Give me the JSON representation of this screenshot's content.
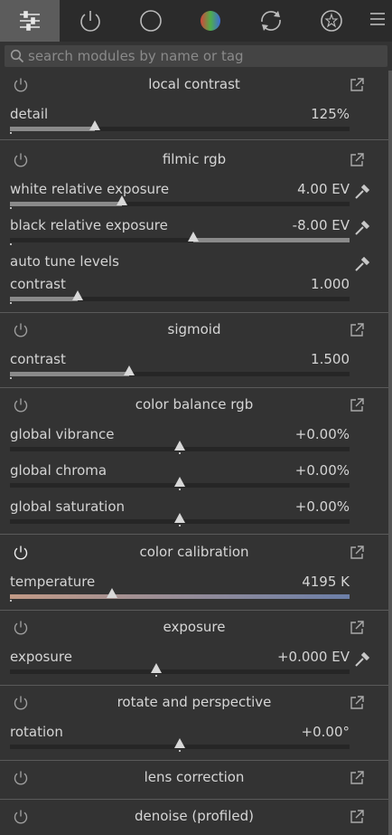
{
  "tabs": [
    {
      "name": "active-modules-tab",
      "icon": "sliders-icon"
    },
    {
      "name": "power-tab",
      "icon": "power-icon"
    },
    {
      "name": "base-tab",
      "icon": "circle-icon"
    },
    {
      "name": "color-tab",
      "icon": "color-wheel-icon"
    },
    {
      "name": "correct-tab",
      "icon": "refresh-icon"
    },
    {
      "name": "effects-tab",
      "icon": "effects-icon"
    }
  ],
  "search": {
    "placeholder": "search modules by name or tag"
  },
  "modules": [
    {
      "title": "local contrast",
      "enabled": false,
      "rows": [
        {
          "label": "detail",
          "value": "125%",
          "fraction": 0.25,
          "picker": false
        }
      ]
    },
    {
      "title": "filmic rgb",
      "enabled": false,
      "rows": [
        {
          "label": "white relative exposure",
          "value": "4.00 EV",
          "fraction": 0.33,
          "picker": true
        },
        {
          "label": "black relative exposure",
          "value": "-8.00 EV",
          "fraction": 0.54,
          "picker": true,
          "fill_right": true
        },
        {
          "label": "auto tune levels",
          "value": "",
          "picker": true,
          "plain": true
        },
        {
          "label": "contrast",
          "value": "1.000",
          "fraction": 0.2,
          "picker": false
        }
      ]
    },
    {
      "title": "sigmoid",
      "enabled": false,
      "rows": [
        {
          "label": "contrast",
          "value": "1.500",
          "fraction": 0.35,
          "picker": false
        }
      ]
    },
    {
      "title": "color balance rgb",
      "enabled": false,
      "rows": [
        {
          "label": "global vibrance",
          "value": "+0.00%",
          "fraction": 0.5,
          "picker": false,
          "centered": true
        },
        {
          "label": "global chroma",
          "value": "+0.00%",
          "fraction": 0.5,
          "picker": false,
          "centered": true
        },
        {
          "label": "global saturation",
          "value": "+0.00%",
          "fraction": 0.5,
          "picker": false,
          "centered": true
        }
      ]
    },
    {
      "title": "color calibration",
      "enabled": true,
      "rows": [
        {
          "label": "temperature",
          "value": "4195 K",
          "fraction": 0.3,
          "picker": false,
          "gradient": true
        }
      ]
    },
    {
      "title": "exposure",
      "enabled": false,
      "rows": [
        {
          "label": "exposure",
          "value": "+0.000 EV",
          "fraction": 0.43,
          "picker": true,
          "centered": true
        }
      ]
    },
    {
      "title": "rotate and perspective",
      "enabled": false,
      "rows": [
        {
          "label": "rotation",
          "value": "+0.00°",
          "fraction": 0.5,
          "picker": false,
          "centered": true
        }
      ]
    },
    {
      "title": "lens correction",
      "enabled": false,
      "rows": []
    },
    {
      "title": "denoise (profiled)",
      "enabled": false,
      "rows": []
    }
  ],
  "colors": {
    "gradient_start": "#c29a86",
    "gradient_end": "#6c7fa8"
  }
}
